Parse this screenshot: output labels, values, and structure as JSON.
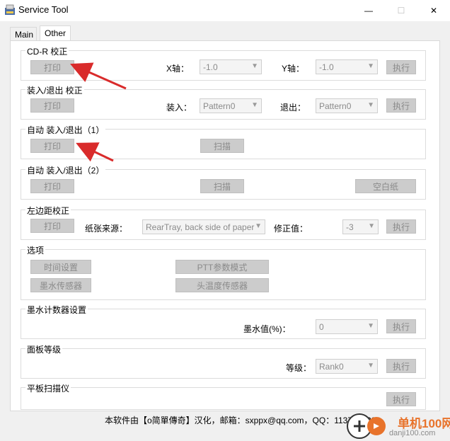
{
  "window": {
    "title": "Service Tool",
    "controls": {
      "minimize": "—",
      "maximize": "☐",
      "close": "✕"
    }
  },
  "tabs": [
    {
      "label": "Main",
      "active": false
    },
    {
      "label": "Other",
      "active": true
    }
  ],
  "groups": {
    "cdr": {
      "legend": "CD-R 校正",
      "print_label": "打印",
      "x_label": "X轴：",
      "x_value": "-1.0",
      "y_label": "Y轴：",
      "y_value": "-1.0",
      "execute_label": "执行"
    },
    "load_eject": {
      "legend": "装入/退出 校正",
      "print_label": "打印",
      "load_label": "装入：",
      "load_value": "Pattern0",
      "eject_label": "退出：",
      "eject_value": "Pattern0",
      "execute_label": "执行"
    },
    "auto1": {
      "legend": "自动 装入/退出（1）",
      "print_label": "打印",
      "scan_label": "扫描"
    },
    "auto2": {
      "legend": "自动 装入/退出（2）",
      "print_label": "打印",
      "scan_label": "扫描",
      "blank_label": "空白纸"
    },
    "left_margin": {
      "legend": "左边距校正",
      "print_label": "打印",
      "source_label": "纸张来源：",
      "source_value": "RearTray, back side of paper",
      "correction_label": "修正值：",
      "correction_value": "-3",
      "execute_label": "执行"
    },
    "options": {
      "legend": "选项",
      "time_label": "时间设置",
      "ptt_label": "PTT参数模式",
      "ink_sensor_label": "墨水传感器",
      "head_temp_label": "头温度传感器"
    },
    "ink_counter": {
      "legend": "墨水计数器设置",
      "ink_value_label": "墨水值(%)：",
      "ink_value": "0",
      "execute_label": "执行"
    },
    "panel_rank": {
      "legend": "面板等级",
      "rank_label": "等级：",
      "rank_value": "Rank0",
      "execute_label": "执行"
    },
    "flatbed": {
      "legend": "平板扫描仪",
      "execute_label": "执行"
    }
  },
  "footer": "本软件由【o简單傳奇】汉化，邮箱：sxppx@qq.com，QQ：1137798333",
  "watermark": {
    "main": "单机100网",
    "sub": "danji100.com"
  },
  "colors": {
    "arrow": "#d92b2b",
    "watermark": "#e8732b"
  }
}
